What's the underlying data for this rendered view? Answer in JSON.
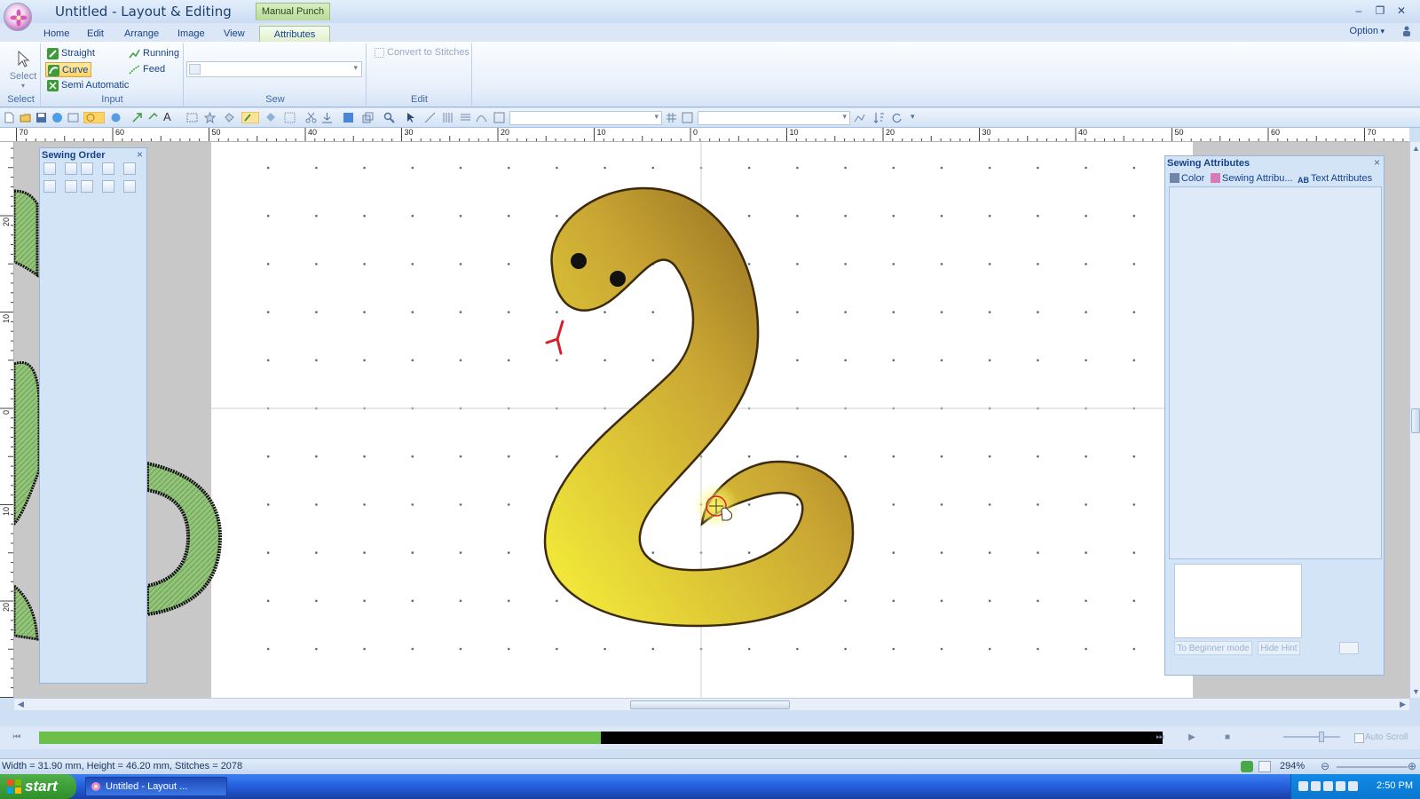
{
  "window": {
    "title": "Untitled - Layout & Editing",
    "context_tab": "Manual Punch"
  },
  "ribbon_tabs": [
    "Home",
    "Edit",
    "Arrange",
    "Image",
    "View",
    "Attributes"
  ],
  "active_tab": "Attributes",
  "option_menu": "Option",
  "ribbon": {
    "select_label": "Select",
    "select_group": "Select",
    "input_group": "Input",
    "input_buttons": {
      "straight": "Straight",
      "curve": "Curve",
      "semi_automatic": "Semi Automatic",
      "running": "Running",
      "feed": "Feed"
    },
    "pressed_button": "Curve",
    "sew_group": "Sew",
    "edit_group": "Edit",
    "convert_to_stitches": "Convert to Stitches"
  },
  "rulers": {
    "unit": "mm",
    "h_labels": [
      "70",
      "60",
      "50",
      "40",
      "30",
      "20",
      "10",
      "0",
      "10",
      "20",
      "30",
      "40",
      "50",
      "60",
      "70"
    ],
    "v_labels": [
      "20",
      "10",
      "0",
      "10",
      "20"
    ]
  },
  "sewing_order_panel": {
    "title": "Sewing Order",
    "close": "×"
  },
  "sewing_attributes_panel": {
    "title": "Sewing Attributes",
    "close": "×",
    "tabs": [
      "Color",
      "Sewing Attribu...",
      "Text Attributes"
    ],
    "beginner_mode_button": "To Beginner mode",
    "hide_hint_button": "Hide Hint"
  },
  "playback": {
    "progress": 0.5,
    "auto_scroll_label": "Auto Scroll"
  },
  "status": {
    "text": "Width = 31.90 mm, Height = 46.20 mm, Stitches = 2078",
    "zoom": "294%"
  },
  "taskbar": {
    "start_label": "start",
    "task_item": "Untitled - Layout ...",
    "clock": "2:50 PM"
  },
  "colors": {
    "snake_light": "#f8f23a",
    "snake_dark": "#7a5218",
    "tongue": "#d8202a",
    "stitch_green": "#92c47a",
    "progress_green": "#6cc04a"
  },
  "icons": {
    "cursor": "crosshair-hand-cursor-icon"
  }
}
